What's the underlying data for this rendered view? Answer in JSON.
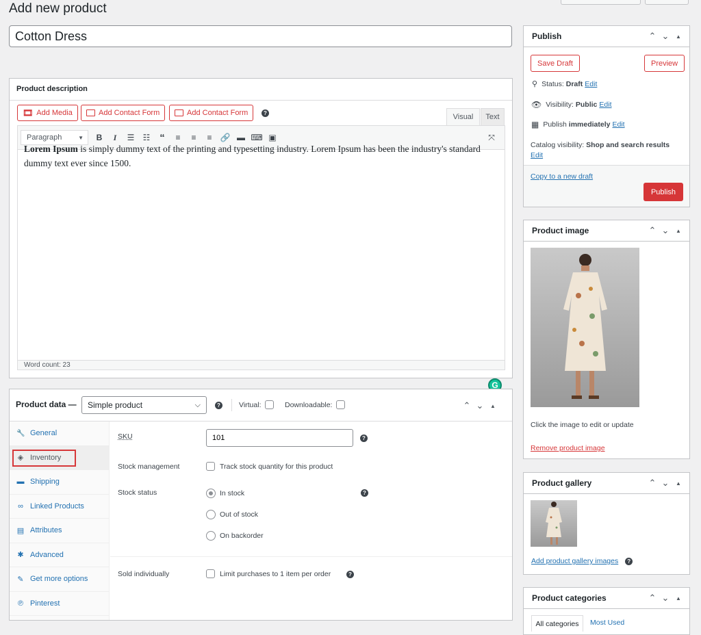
{
  "page": {
    "title": "Add new product"
  },
  "product_title": {
    "value": "Cotton Dress"
  },
  "description_box": {
    "title": "Product description",
    "add_media": "Add Media",
    "contact_form_1": "Add Contact Form",
    "contact_form_2": "Add Contact Form",
    "tab_visual": "Visual",
    "tab_text": "Text",
    "format_select": "Paragraph",
    "content_bold": "Lorem Ipsum",
    "content_rest": " is simply dummy text of the printing and typesetting industry. Lorem Ipsum has been the industry's standard dummy text ever since 1500.",
    "word_count": "Word count: 23",
    "grammarly_letter": "G"
  },
  "product_data": {
    "label": "Product data —",
    "type_value": "Simple product",
    "virtual_label": "Virtual:",
    "downloadable_label": "Downloadable:",
    "tabs": [
      {
        "label": "General",
        "icon": "wrench-icon",
        "glyph": "🔧"
      },
      {
        "label": "Inventory",
        "icon": "tag-icon",
        "glyph": "◈"
      },
      {
        "label": "Shipping",
        "icon": "truck-icon",
        "glyph": "▬"
      },
      {
        "label": "Linked Products",
        "icon": "link-icon",
        "glyph": "∞"
      },
      {
        "label": "Attributes",
        "icon": "list-icon",
        "glyph": "▤"
      },
      {
        "label": "Advanced",
        "icon": "gear-icon",
        "glyph": "✱"
      },
      {
        "label": "Get more options",
        "icon": "plugin-icon",
        "glyph": "✎"
      },
      {
        "label": "Pinterest",
        "icon": "pinterest-icon",
        "glyph": "℗"
      }
    ],
    "sku_label": "SKU",
    "sku_value": "101",
    "stock_mgmt_label": "Stock management",
    "stock_mgmt_cb_label": "Track stock quantity for this product",
    "stock_status_label": "Stock status",
    "stock_options": [
      "In stock",
      "Out of stock",
      "On backorder"
    ],
    "sold_ind_label": "Sold individually",
    "sold_ind_cb_label": "Limit purchases to 1 item per order"
  },
  "publish": {
    "title": "Publish",
    "save_draft": "Save Draft",
    "preview": "Preview",
    "status_label": "Status:",
    "status_value": "Draft",
    "visibility_label": "Visibility:",
    "visibility_value": "Public",
    "publish_label": "Publish",
    "publish_value": "immediately",
    "catalog_label": "Catalog visibility:",
    "catalog_value": "Shop and search results",
    "edit": "Edit",
    "copy_draft": "Copy to a new draft",
    "publish_button": "Publish"
  },
  "product_image": {
    "title": "Product image",
    "hint": "Click the image to edit or update",
    "remove": "Remove product image"
  },
  "gallery": {
    "title": "Product gallery",
    "add": "Add product gallery images"
  },
  "categories": {
    "title": "Product categories",
    "tab_all": "All categories",
    "tab_most": "Most Used"
  },
  "colors": {
    "accent": "#2271b1",
    "danger": "#d63638",
    "highlight_box": "#d63638"
  }
}
